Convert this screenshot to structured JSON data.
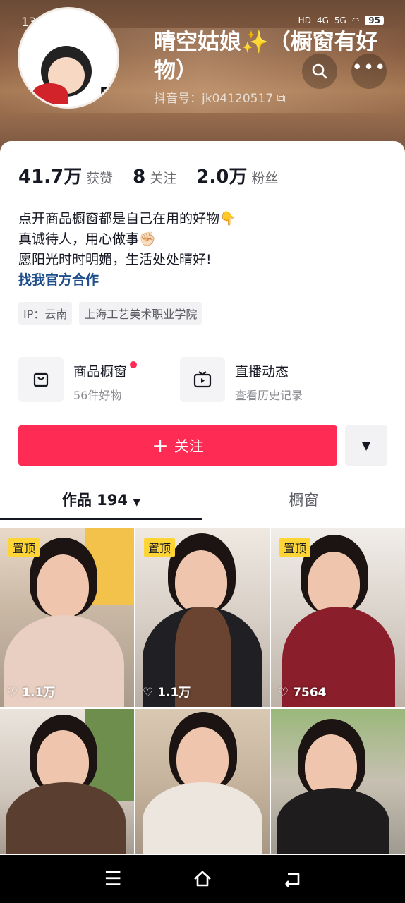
{
  "status_bar": {
    "time": "13:38",
    "battery": "95",
    "network_labels": [
      "HD",
      "4G",
      "5G"
    ]
  },
  "profile": {
    "nickname": "晴空姑娘✨（橱窗有好物）",
    "douyin_id": "抖音号：jk04120517"
  },
  "stats": [
    {
      "value": "41.7万",
      "label": "获赞"
    },
    {
      "value": "8",
      "label": "关注"
    },
    {
      "value": "2.0万",
      "label": "粉丝"
    }
  ],
  "bio": {
    "lines": [
      "点开商品橱窗都是自己在用的好物👇",
      "真诚待人，用心做事✊🏻",
      "愿阳光时时明媚，生活处处晴好!"
    ],
    "link": "找我官方合作"
  },
  "tags": [
    "IP：云南",
    "上海工艺美术职业学院"
  ],
  "features": [
    {
      "title": "商品橱窗",
      "subtitle": "56件好物",
      "icon": "shopping-bag-icon"
    },
    {
      "title": "直播动态",
      "subtitle": "查看历史记录",
      "icon": "tv-icon"
    }
  ],
  "follow_button": {
    "label": "关注",
    "icon": "plus-icon"
  },
  "tabs": [
    {
      "label": "作品 194",
      "active": true
    },
    {
      "label": "橱窗",
      "active": false
    }
  ],
  "videos": [
    {
      "pinned": "置顶",
      "likes": "1.1万"
    },
    {
      "pinned": "置顶",
      "likes": "1.1万"
    },
    {
      "pinned": "置顶",
      "likes": "7564"
    },
    {
      "pinned": "",
      "likes": ""
    },
    {
      "pinned": "",
      "likes": ""
    },
    {
      "pinned": "",
      "likes": ""
    }
  ],
  "colors": {
    "accent": "#fe2c55",
    "pin_badge": "#fed535",
    "link": "#1f4e8c"
  }
}
